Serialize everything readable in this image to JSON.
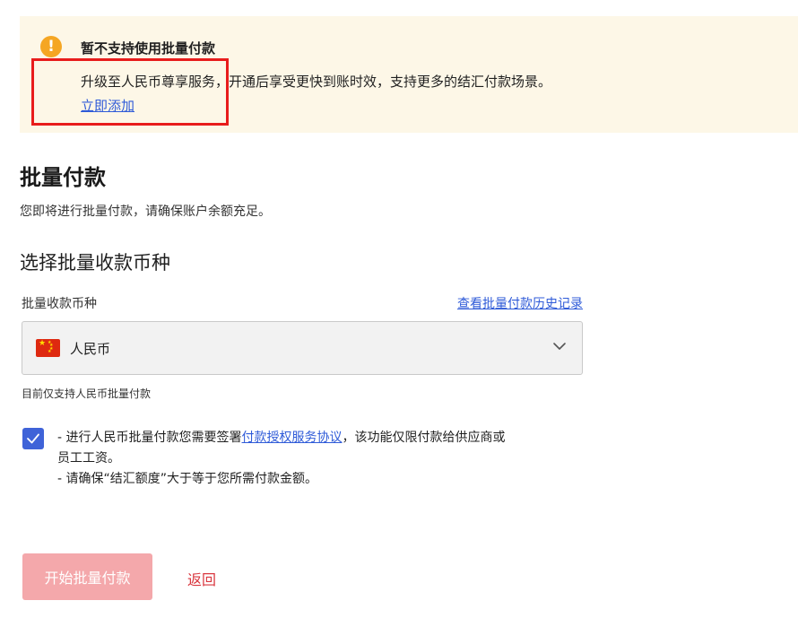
{
  "banner": {
    "icon": "warning-icon",
    "icon_glyph": "!",
    "title": "暂不支持使用批量付款",
    "description": "升级至人民币尊享服务，开通后享受更快到账时效，支持更多的结汇付款场景。",
    "link_label": "立即添加",
    "background_color": "#fdf7e7",
    "icon_color": "#f5a623"
  },
  "page": {
    "title": "批量付款",
    "subtitle": "您即将进行批量付款，请确保账户余额充足。"
  },
  "currency_section": {
    "title": "选择批量收款币种",
    "field_label": "批量收款币种",
    "history_link": "查看批量付款历史记录",
    "selected_currency": "人民币",
    "selected_flag": "china-flag-icon",
    "hint": "目前仅支持人民币批量付款"
  },
  "agreement": {
    "checked": true,
    "line1_prefix": "- 进行人民币批量付款您需要签署",
    "link_label": "付款授权服务协议",
    "line1_suffix": "，该功能仅限付款给供应商或",
    "line2": "员工工资。",
    "line3": "- 请确保“结汇额度”大于等于您所需付款金额。"
  },
  "actions": {
    "start_label": "开始批量付款",
    "back_label": "返回",
    "start_color": "#f4a8ab",
    "back_color": "#d9363e"
  },
  "colors": {
    "link": "#2f5bd8",
    "checkbox": "#3f63d8",
    "highlight_box": "#e81c1c"
  }
}
